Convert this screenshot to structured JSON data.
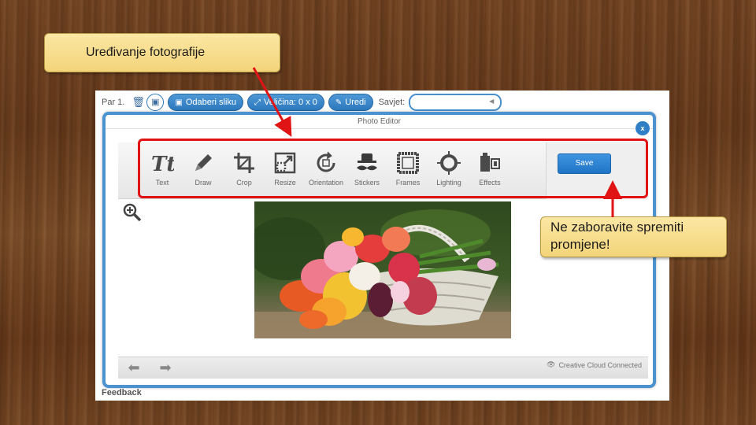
{
  "callouts": {
    "title": "Uređivanje fotografije",
    "reminder": "Ne zaboravite spremiti promjene!"
  },
  "topbar": {
    "part_label": "Par 1.",
    "choose_image": "Odaberi sliku",
    "size": "Veličina: 0 x 0",
    "edit": "Uredi",
    "tip_label": "Savjet:",
    "tip_value": ""
  },
  "editor": {
    "header_title": "Photo Editor",
    "close_label": "x",
    "tools": [
      "Text",
      "Draw",
      "Crop",
      "Resize",
      "Orientation",
      "Stickers",
      "Frames",
      "Lighting",
      "Effects"
    ],
    "save_label": "Save",
    "status_label": "Creative Cloud Connected"
  },
  "footer": {
    "feedback": "Feedback"
  },
  "icons": {
    "topbar": [
      "trash-icon",
      "image-icon",
      "resize-arrows-icon",
      "edit-icon"
    ],
    "tools": [
      "text-icon",
      "pencil-icon",
      "crop-icon",
      "resize-icon",
      "rotate-icon",
      "mustache-hat-icon",
      "frame-icon",
      "sun-icon",
      "effects-icon"
    ],
    "canvas": [
      "zoom-in-icon",
      "undo-icon",
      "redo-icon",
      "eye-icon"
    ]
  },
  "colors": {
    "annotation_red": "#e01414",
    "accent_blue": "#2f7fc7",
    "callout_yellow": "#f6dc87"
  }
}
